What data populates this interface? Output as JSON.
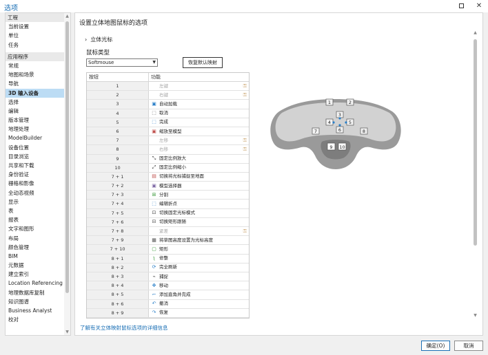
{
  "window": {
    "title": "选项"
  },
  "nav": {
    "items": [
      {
        "label": "工程",
        "kind": "section"
      },
      {
        "label": "当前设置",
        "kind": "item"
      },
      {
        "label": "单位",
        "kind": "item"
      },
      {
        "label": "任务",
        "kind": "item"
      },
      {
        "label": "",
        "kind": "gap"
      },
      {
        "label": "应用程序",
        "kind": "section"
      },
      {
        "label": "常规",
        "kind": "item"
      },
      {
        "label": "地图和场景",
        "kind": "item"
      },
      {
        "label": "导航",
        "kind": "item"
      },
      {
        "label": "3D 输入设备",
        "kind": "item",
        "selected": true
      },
      {
        "label": "选择",
        "kind": "item"
      },
      {
        "label": "编辑",
        "kind": "item"
      },
      {
        "label": "版本管理",
        "kind": "item"
      },
      {
        "label": "地理处理",
        "kind": "item"
      },
      {
        "label": "ModelBuilder",
        "kind": "item"
      },
      {
        "label": "设备位置",
        "kind": "item"
      },
      {
        "label": "目录浏览",
        "kind": "item"
      },
      {
        "label": "共享和下载",
        "kind": "item"
      },
      {
        "label": "身份验证",
        "kind": "item"
      },
      {
        "label": "栅格和影像",
        "kind": "item"
      },
      {
        "label": "全动态视频",
        "kind": "item"
      },
      {
        "label": "显示",
        "kind": "item"
      },
      {
        "label": "表",
        "kind": "item"
      },
      {
        "label": "报表",
        "kind": "item"
      },
      {
        "label": "文字和图形",
        "kind": "item"
      },
      {
        "label": "布局",
        "kind": "item"
      },
      {
        "label": "颜色管理",
        "kind": "item"
      },
      {
        "label": "BIM",
        "kind": "item"
      },
      {
        "label": "元数据",
        "kind": "item"
      },
      {
        "label": "建立索引",
        "kind": "item"
      },
      {
        "label": "Location Referencing",
        "kind": "item"
      },
      {
        "label": "地理数据库复制",
        "kind": "item"
      },
      {
        "label": "知识图谱",
        "kind": "item"
      },
      {
        "label": "Business Analyst",
        "kind": "item"
      },
      {
        "label": "校对",
        "kind": "item"
      }
    ]
  },
  "main": {
    "title": "设置立体地图鼠标的选项",
    "expander_label": "立体光标",
    "mouse_type_label": "鼠标类型",
    "mouse_type_value": "Softmouse",
    "restore_button": "恢复默认映射",
    "table": {
      "col_button": "按钮",
      "col_function": "功能",
      "rows": [
        {
          "key": "1",
          "func": "左键",
          "icon": "",
          "disabled": true,
          "locked": true
        },
        {
          "key": "2",
          "func": "右键",
          "icon": "",
          "disabled": true,
          "locked": true
        },
        {
          "key": "3",
          "func": "自动加载",
          "icon": "autoload-icon",
          "disabled": false,
          "locked": false
        },
        {
          "key": "4",
          "func": "取消",
          "icon": "cancel-icon",
          "disabled": false,
          "locked": false
        },
        {
          "key": "5",
          "func": "完成",
          "icon": "finish-icon",
          "disabled": false,
          "locked": false
        },
        {
          "key": "6",
          "func": "缩放至模型",
          "icon": "zoom-model-icon",
          "disabled": false,
          "locked": false
        },
        {
          "key": "7",
          "func": "左移",
          "icon": "",
          "disabled": true,
          "locked": true
        },
        {
          "key": "8",
          "func": "右移",
          "icon": "",
          "disabled": true,
          "locked": true
        },
        {
          "key": "9",
          "func": "固定比例放大",
          "icon": "fixed-zoom-in-icon",
          "disabled": false,
          "locked": false
        },
        {
          "key": "10",
          "func": "固定比例缩小",
          "icon": "fixed-zoom-out-icon",
          "disabled": false,
          "locked": false
        },
        {
          "key": "7 + 1",
          "func": "切换将光标捕捉至地面",
          "icon": "snap-ground-icon",
          "disabled": false,
          "locked": false
        },
        {
          "key": "7 + 2",
          "func": "模型选择器",
          "icon": "model-selector-icon",
          "disabled": false,
          "locked": false
        },
        {
          "key": "7 + 3",
          "func": "分割",
          "icon": "split-icon",
          "disabled": false,
          "locked": false
        },
        {
          "key": "7 + 4",
          "func": "编辑折点",
          "icon": "edit-vertices-icon",
          "disabled": false,
          "locked": false
        },
        {
          "key": "7 + 5",
          "func": "切换固定光标模式",
          "icon": "fixed-cursor-icon",
          "disabled": false,
          "locked": false
        },
        {
          "key": "7 + 6",
          "func": "切换矩形跟随",
          "icon": "rect-follow-icon",
          "disabled": false,
          "locked": false
        },
        {
          "key": "7 + 8",
          "func": "紧差",
          "icon": "",
          "disabled": true,
          "locked": true
        },
        {
          "key": "7 + 9",
          "func": "将草图高度设置为光标高度",
          "icon": "sketch-height-icon",
          "disabled": false,
          "locked": false
        },
        {
          "key": "7 + 10",
          "func": "矩形",
          "icon": "rectangle-icon",
          "disabled": false,
          "locked": false
        },
        {
          "key": "8 + 1",
          "func": "修整",
          "icon": "reshape-icon",
          "disabled": false,
          "locked": false
        },
        {
          "key": "8 + 2",
          "func": "完全刷新",
          "icon": "refresh-icon",
          "disabled": false,
          "locked": false
        },
        {
          "key": "8 + 3",
          "func": "捕捉",
          "icon": "snap-icon",
          "disabled": false,
          "locked": false
        },
        {
          "key": "8 + 4",
          "func": "移动",
          "icon": "move-icon",
          "disabled": false,
          "locked": false
        },
        {
          "key": "8 + 5",
          "func": "添加直角并完成",
          "icon": "right-angle-icon",
          "disabled": false,
          "locked": false
        },
        {
          "key": "8 + 6",
          "func": "撤消",
          "icon": "undo-icon",
          "disabled": false,
          "locked": false
        },
        {
          "key": "8 + 9",
          "func": "恢复",
          "icon": "redo-icon",
          "disabled": false,
          "locked": false
        }
      ]
    },
    "help_link": "了解有关立体映射鼠标选项的详细信息",
    "device_buttons": [
      "1",
      "2",
      "3",
      "4",
      "5",
      "6",
      "7",
      "8",
      "9",
      "10"
    ]
  },
  "footer": {
    "ok_label": "确定(O)",
    "cancel_label": "取消"
  },
  "colors": {
    "accent": "#1a6fb5",
    "selected": "#bcdcf4",
    "lock": "#c9a26a"
  }
}
